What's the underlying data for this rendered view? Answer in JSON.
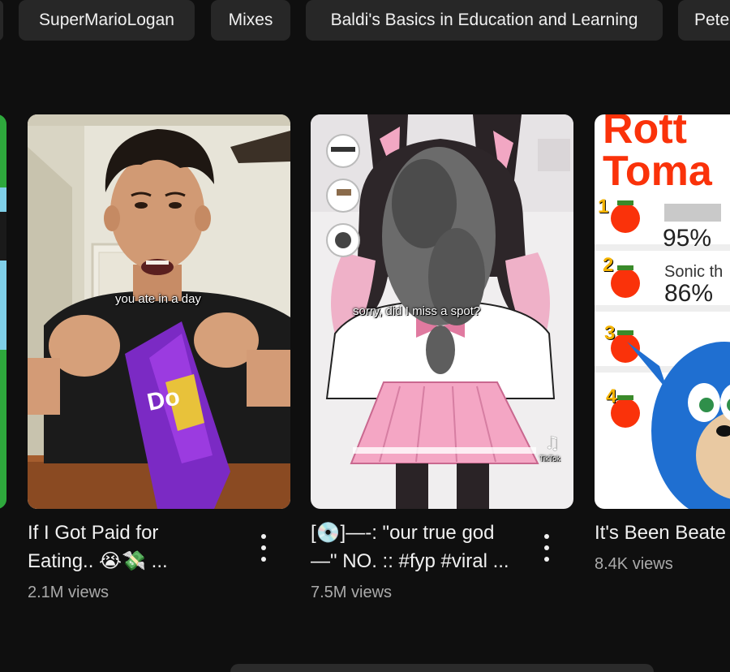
{
  "chips": [
    "",
    "SuperMarioLogan",
    "Mixes",
    "Baldi's Basics in Education and Learning",
    "Pete"
  ],
  "shorts": [
    {
      "overlay": "you ate in a day",
      "title_line1": "If I Got Paid for",
      "title_line2": "Eating.. 😭💸 ...",
      "views": "2.1M views"
    },
    {
      "overlay": "sorry, did I miss a spot?",
      "title_line1": "[💿]—-: \"our true god",
      "title_line2": "—\" NO. :: #fyp #viral ...",
      "views": "7.5M views",
      "watermark": "TikTok"
    },
    {
      "banner_line1": "Rott",
      "banner_line2": "Toma",
      "rank_rows": [
        {
          "rank": "1",
          "name": "",
          "score": "95%"
        },
        {
          "rank": "2",
          "name": "Sonic th",
          "score": "86%"
        },
        {
          "rank": "3",
          "name": "",
          "score": ""
        },
        {
          "rank": "4",
          "name": "",
          "score": ""
        }
      ],
      "title_line1": "It's Been Beate",
      "views": "8.4K views"
    }
  ],
  "colors": {
    "background": "#0f0f0f",
    "chip": "#272727",
    "text_primary": "#f1f1f1",
    "text_secondary": "#aaaaaa",
    "tomato_red": "#fa320a"
  },
  "icons": [
    "more-vert-icon",
    "tiktok-icon"
  ]
}
